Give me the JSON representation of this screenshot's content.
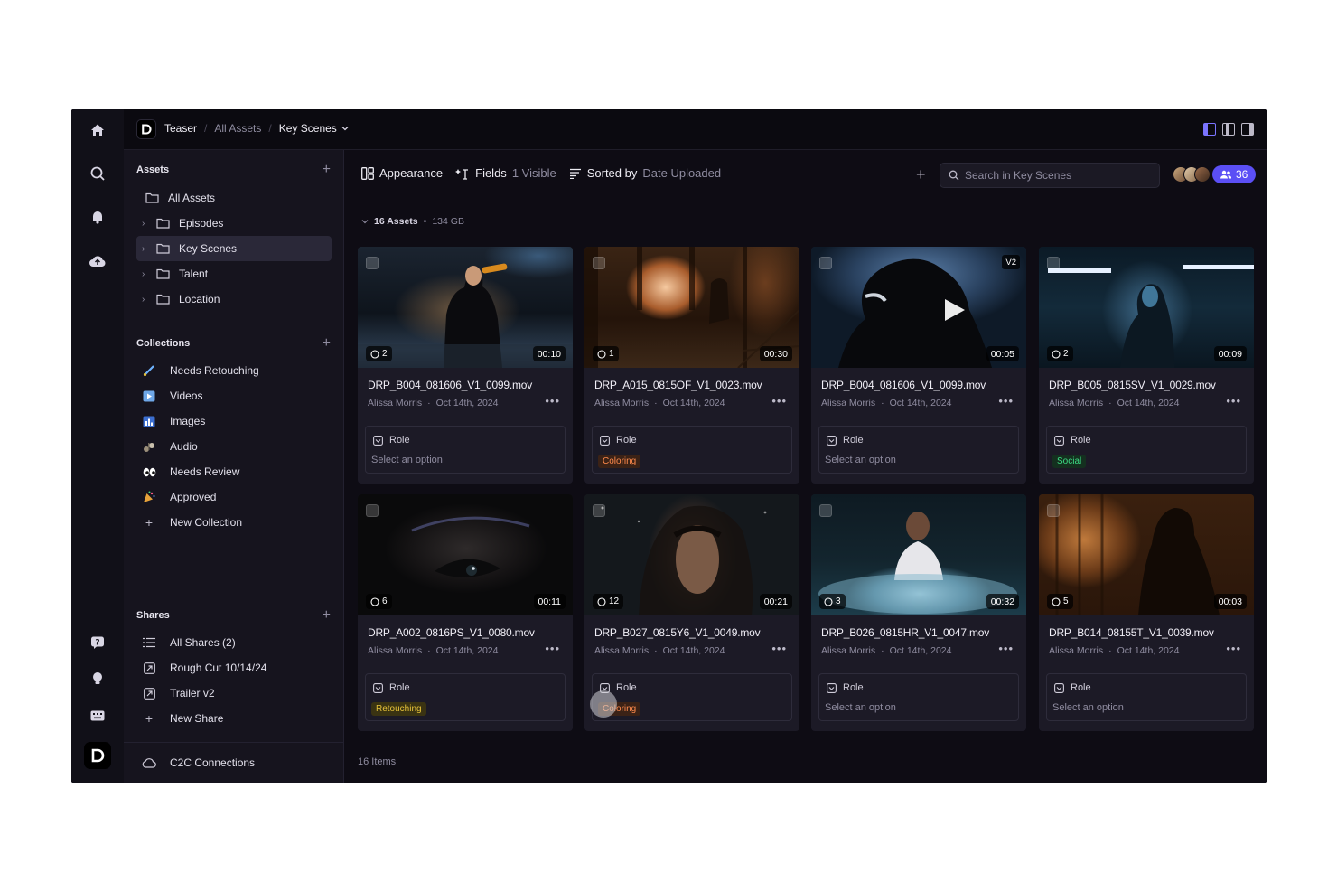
{
  "topbar": {
    "workspace": "Teaser",
    "crumb_parent": "All Assets",
    "crumb_current": "Key Scenes"
  },
  "sidebar": {
    "assets_title": "Assets",
    "assets": [
      {
        "label": "All Assets",
        "chevron": false
      },
      {
        "label": "Episodes",
        "chevron": true
      },
      {
        "label": "Key Scenes",
        "chevron": true,
        "active": true
      },
      {
        "label": "Talent",
        "chevron": true
      },
      {
        "label": "Location",
        "chevron": true
      }
    ],
    "collections_title": "Collections",
    "collections": [
      {
        "label": "Needs Retouching",
        "icon": "brush-icon"
      },
      {
        "label": "Videos",
        "icon": "video-icon"
      },
      {
        "label": "Images",
        "icon": "image-icon"
      },
      {
        "label": "Audio",
        "icon": "audio-icon"
      },
      {
        "label": "Needs Review",
        "icon": "eyes-icon"
      },
      {
        "label": "Approved",
        "icon": "party-icon"
      },
      {
        "label": "New Collection",
        "icon": "plus-icon"
      }
    ],
    "shares_title": "Shares",
    "shares": [
      {
        "label": "All Shares (2)",
        "icon": "list-icon"
      },
      {
        "label": "Rough Cut 10/14/24",
        "icon": "share-icon"
      },
      {
        "label": "Trailer v2",
        "icon": "share-icon"
      },
      {
        "label": "New Share",
        "icon": "plus-icon"
      }
    ],
    "connections": "C2C Connections"
  },
  "toolbar": {
    "appearance": "Appearance",
    "fields": "Fields",
    "fields_count": "1 Visible",
    "sorted_by": "Sorted by",
    "sorted_field": "Date Uploaded",
    "search_placeholder": "Search in Key Scenes",
    "members_count": "36"
  },
  "summary": {
    "assets": "16 Assets",
    "size": "134 GB"
  },
  "cards": [
    {
      "name": "DRP_B004_081606_V1_0099.mov",
      "author": "Alissa Morris",
      "date": "Oct 14th, 2024",
      "comments": "2",
      "duration": "00:10",
      "role_label": "Role",
      "role_value": "Select an option",
      "tag": ""
    },
    {
      "name": "DRP_A015_0815OF_V1_0023.mov",
      "author": "Alissa Morris",
      "date": "Oct 14th, 2024",
      "comments": "1",
      "duration": "00:30",
      "role_label": "Role",
      "role_value": "Coloring",
      "tag": "coloring"
    },
    {
      "name": "DRP_B004_081606_V1_0099.mov",
      "author": "Alissa Morris",
      "date": "Oct 14th, 2024",
      "comments": "",
      "duration": "00:05",
      "version": "V2",
      "role_label": "Role",
      "role_value": "Select an option",
      "tag": ""
    },
    {
      "name": "DRP_B005_0815SV_V1_0029.mov",
      "author": "Alissa Morris",
      "date": "Oct 14th, 2024",
      "comments": "2",
      "duration": "00:09",
      "role_label": "Role",
      "role_value": "Social",
      "tag": "social"
    },
    {
      "name": "DRP_A002_0816PS_V1_0080.mov",
      "author": "Alissa Morris",
      "date": "Oct 14th, 2024",
      "comments": "6",
      "duration": "00:11",
      "role_label": "Role",
      "role_value": "Retouching",
      "tag": "retouching"
    },
    {
      "name": "DRP_B027_0815Y6_V1_0049.mov",
      "author": "Alissa Morris",
      "date": "Oct 14th, 2024",
      "comments": "12",
      "duration": "00:21",
      "role_label": "Role",
      "role_value": "Coloring",
      "tag": "coloring"
    },
    {
      "name": "DRP_B026_0815HR_V1_0047.mov",
      "author": "Alissa Morris",
      "date": "Oct 14th, 2024",
      "comments": "3",
      "duration": "00:32",
      "role_label": "Role",
      "role_value": "Select an option",
      "tag": ""
    },
    {
      "name": "DRP_B014_08155T_V1_0039.mov",
      "author": "Alissa Morris",
      "date": "Oct 14th, 2024",
      "comments": "5",
      "duration": "00:03",
      "role_label": "Role",
      "role_value": "Select an option",
      "tag": ""
    }
  ],
  "footer": {
    "items": "16 Items"
  },
  "colors": {
    "accent": "#5b4ff5",
    "background": "#0e0c14",
    "sidebar": "#16141e",
    "coloring": "#ff8a4c",
    "social": "#3ddc84",
    "retouching": "#e6c23a"
  }
}
